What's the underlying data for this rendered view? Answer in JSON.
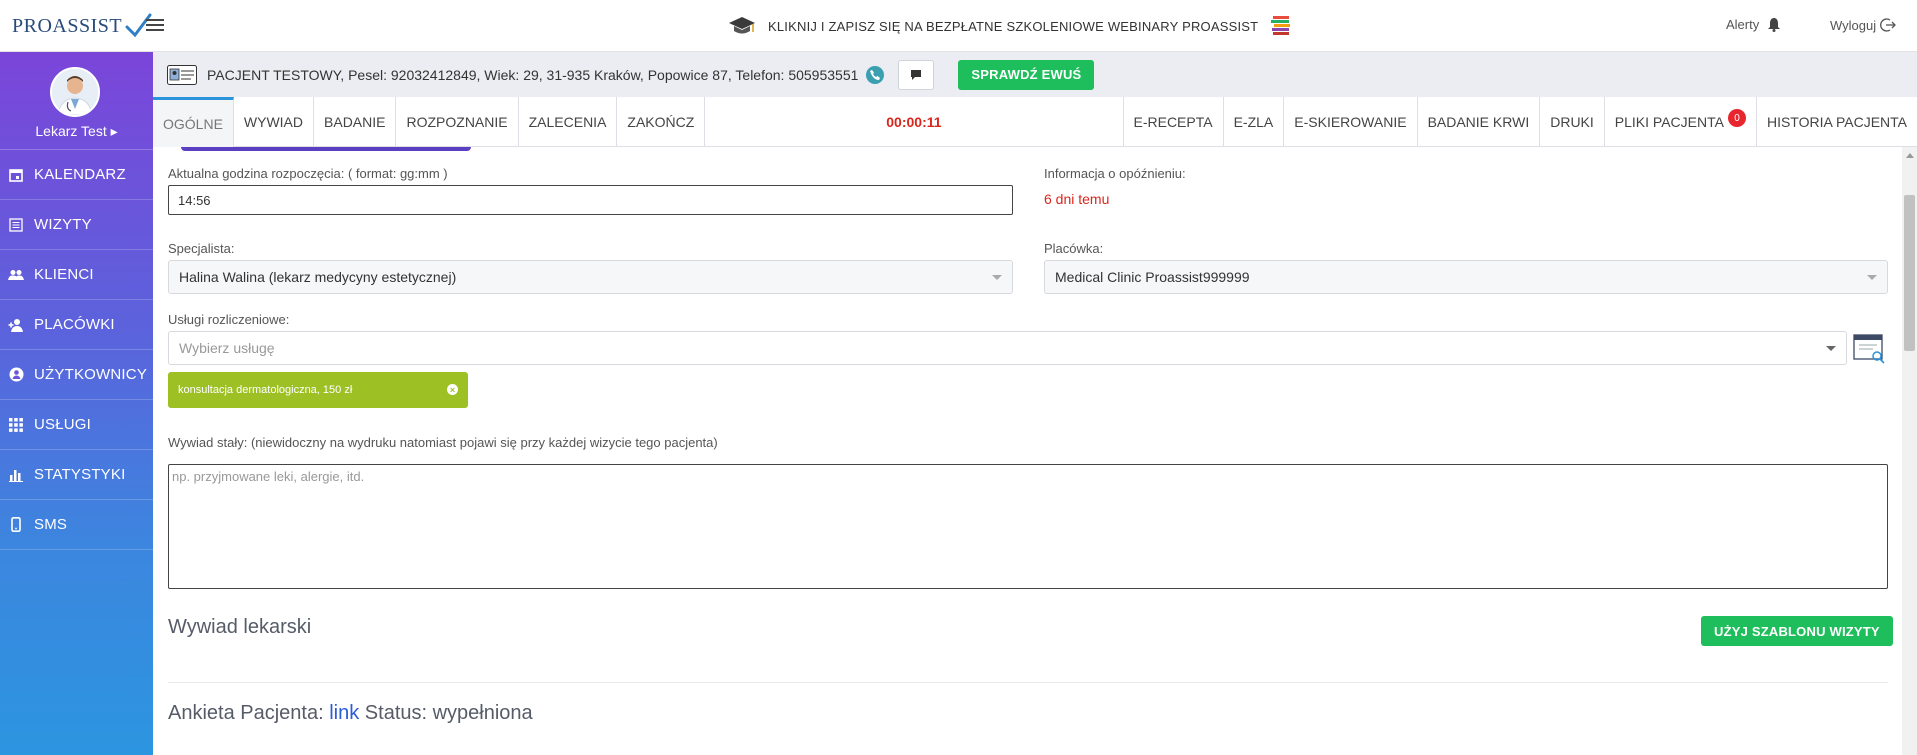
{
  "topbar": {
    "logo_text": "PROASSIST",
    "webinar_text": "KLIKNIJ I ZAPISZ SIĘ NA BEZPŁATNE SZKOLENIOWE WEBINARY PROASSIST",
    "alerts_label": "Alerty",
    "logout_label": "Wyloguj"
  },
  "sidebar": {
    "user_name": "Lekarz Test ▸",
    "items": [
      {
        "label": "KALENDARZ",
        "icon": "calendar-icon"
      },
      {
        "label": "WIZYTY",
        "icon": "list-icon"
      },
      {
        "label": "KLIENCI",
        "icon": "users-icon"
      },
      {
        "label": "PLACÓWKI",
        "icon": "user-plus-icon"
      },
      {
        "label": "UŻYTKOWNICY",
        "icon": "user-circle-icon"
      },
      {
        "label": "USŁUGI",
        "icon": "grid-icon"
      },
      {
        "label": "STATYSTYKI",
        "icon": "bar-chart-icon"
      },
      {
        "label": "SMS",
        "icon": "mobile-icon"
      }
    ]
  },
  "patient": {
    "info": "PACJENT TESTOWY, Pesel: 92032412849, Wiek: 29, 31-935 Kraków, Popowice 87, Telefon: 505953551",
    "ewus_label": "SPRAWDŹ EWUŚ"
  },
  "tabs": {
    "left": [
      "OGÓLNE",
      "WYWIAD",
      "BADANIE",
      "ROZPOZNANIE",
      "ZALECENIA",
      "ZAKOŃCZ"
    ],
    "timer": "00:00:11",
    "right": [
      "E-RECEPTA",
      "E-ZLA",
      "E-SKIEROWANIE",
      "BADANIE KRWI",
      "DRUKI",
      "PLIKI PACJENTA",
      "HISTORIA PACJENTA"
    ],
    "files_badge": "0"
  },
  "form": {
    "start_time_label": "Aktualna godzina rozpoczęcia: ( format: gg:mm )",
    "start_time_value": "14:56",
    "delay_label": "Informacja o opóźnieniu:",
    "delay_value": "6 dni temu",
    "specialist_label": "Specjalista:",
    "specialist_value": "Halina Walina (lekarz medycyny estetycznej)",
    "facility_label": "Placówka:",
    "facility_value": "Medical Clinic Proassist999999",
    "services_label": "Usługi rozliczeniowe:",
    "services_placeholder": "Wybierz usługę",
    "selected_service": "konsultacja dermatologiczna, 150 zł",
    "history_label": "Wywiad stały: (niewidoczny na wydruku natomiast pojawi się przy każdej wizycie tego pacjenta)",
    "history_placeholder": "np. przyjmowane leki, alergie, itd."
  },
  "sections": {
    "medical_history_title": "Wywiad lekarski",
    "template_button": "UŻYJ SZABLONU WIZYTY",
    "survey_prefix": "Ankieta Pacjenta:",
    "survey_link": "link",
    "survey_status": "Status: wypełniona"
  },
  "colors": {
    "accent_green": "#1dbe5b",
    "tag_green": "#9dc124",
    "timer_red": "#d9261c",
    "tab_active": "#2b93d9"
  }
}
